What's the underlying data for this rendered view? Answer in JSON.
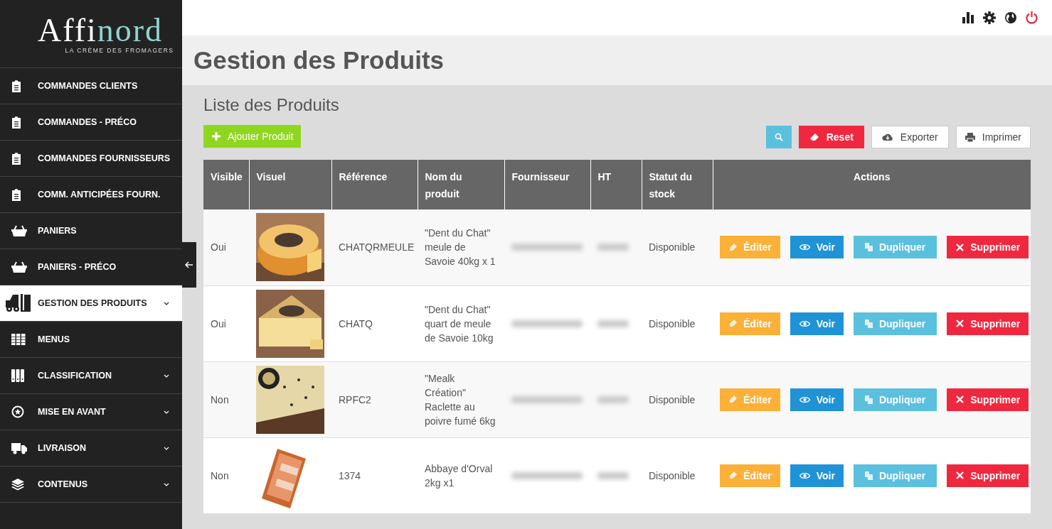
{
  "logo": {
    "light": "Affi",
    "accent": "nord",
    "tagline": "LA CRÈME DES FROMAGERS"
  },
  "sidebar": {
    "items": [
      {
        "label": "COMMANDES CLIENTS",
        "kind": "clipboard",
        "expandable": false,
        "selected": false
      },
      {
        "label": "COMMANDES - PRÉCO",
        "kind": "clipboard",
        "expandable": false,
        "selected": false
      },
      {
        "label": "COMMANDES FOURNISSEURS",
        "kind": "clipboard",
        "expandable": false,
        "selected": false
      },
      {
        "label": "COMM. ANTICIPÉES FOURN.",
        "kind": "clipboard",
        "expandable": false,
        "selected": false
      },
      {
        "label": "PANIERS",
        "kind": "basket",
        "expandable": false,
        "selected": false
      },
      {
        "label": "PANIERS - PRÉCO",
        "kind": "basket",
        "expandable": false,
        "selected": false
      },
      {
        "label": "GESTION DES PRODUITS",
        "kind": "forklift",
        "expandable": true,
        "selected": true
      },
      {
        "label": "MENUS",
        "kind": "grid",
        "expandable": false,
        "selected": false
      },
      {
        "label": "CLASSIFICATION",
        "kind": "binders",
        "expandable": true,
        "selected": false
      },
      {
        "label": "MISE EN AVANT",
        "kind": "star",
        "expandable": true,
        "selected": false
      },
      {
        "label": "LIVRAISON",
        "kind": "truck",
        "expandable": true,
        "selected": false
      },
      {
        "label": "CONTENUS",
        "kind": "layers",
        "expandable": true,
        "selected": false
      }
    ]
  },
  "page_title": "Gestion des Produits",
  "section_title": "Liste des Produits",
  "add_button": "Ajouter Produit",
  "toolbar": [
    {
      "kind": "search"
    },
    {
      "kind": "reset",
      "label": "Reset"
    },
    {
      "kind": "export",
      "label": "Exporter"
    },
    {
      "kind": "print",
      "label": "Imprimer"
    }
  ],
  "table": {
    "columns": [
      "Visible",
      "Visuel",
      "Référence",
      "Nom du produit",
      "Fournisseur",
      "HT",
      "Statut du stock",
      "Actions"
    ],
    "rows": [
      {
        "visible": "Oui",
        "reference": "CHATQRMEULE",
        "name": "\"Dent du Chat\" meule de Savoie 40kg x 1",
        "stock": "Disponible",
        "actions": [
          {
            "kind": "edit",
            "label": "Éditer"
          },
          {
            "kind": "view",
            "label": "Voir"
          },
          {
            "kind": "duplicate",
            "label": "Dupliquer"
          },
          {
            "kind": "delete",
            "label": "Supprimer"
          }
        ]
      },
      {
        "visible": "Oui",
        "reference": "CHATQ",
        "name": "\"Dent du Chat\" quart de meule de Savoie 10kg",
        "stock": "Disponible",
        "actions": [
          {
            "kind": "edit",
            "label": "Éditer"
          },
          {
            "kind": "view",
            "label": "Voir"
          },
          {
            "kind": "duplicate",
            "label": "Dupliquer"
          },
          {
            "kind": "delete",
            "label": "Supprimer"
          }
        ]
      },
      {
        "visible": "Non",
        "reference": "RPFC2",
        "name": "\"Mealk Création\" Raclette au poivre fumé 6kg",
        "stock": "Disponible",
        "actions": [
          {
            "kind": "edit",
            "label": "Éditer"
          },
          {
            "kind": "view",
            "label": "Voir"
          },
          {
            "kind": "duplicate",
            "label": "Dupliquer"
          },
          {
            "kind": "delete",
            "label": "Supprimer"
          }
        ]
      },
      {
        "visible": "Non",
        "reference": "1374",
        "name": "Abbaye d'Orval 2kg x1",
        "stock": "Disponible",
        "actions": [
          {
            "kind": "edit",
            "label": "Éditer"
          },
          {
            "kind": "view",
            "label": "Voir"
          },
          {
            "kind": "duplicate",
            "label": "Dupliquer"
          },
          {
            "kind": "delete",
            "label": "Supprimer"
          }
        ]
      }
    ]
  }
}
